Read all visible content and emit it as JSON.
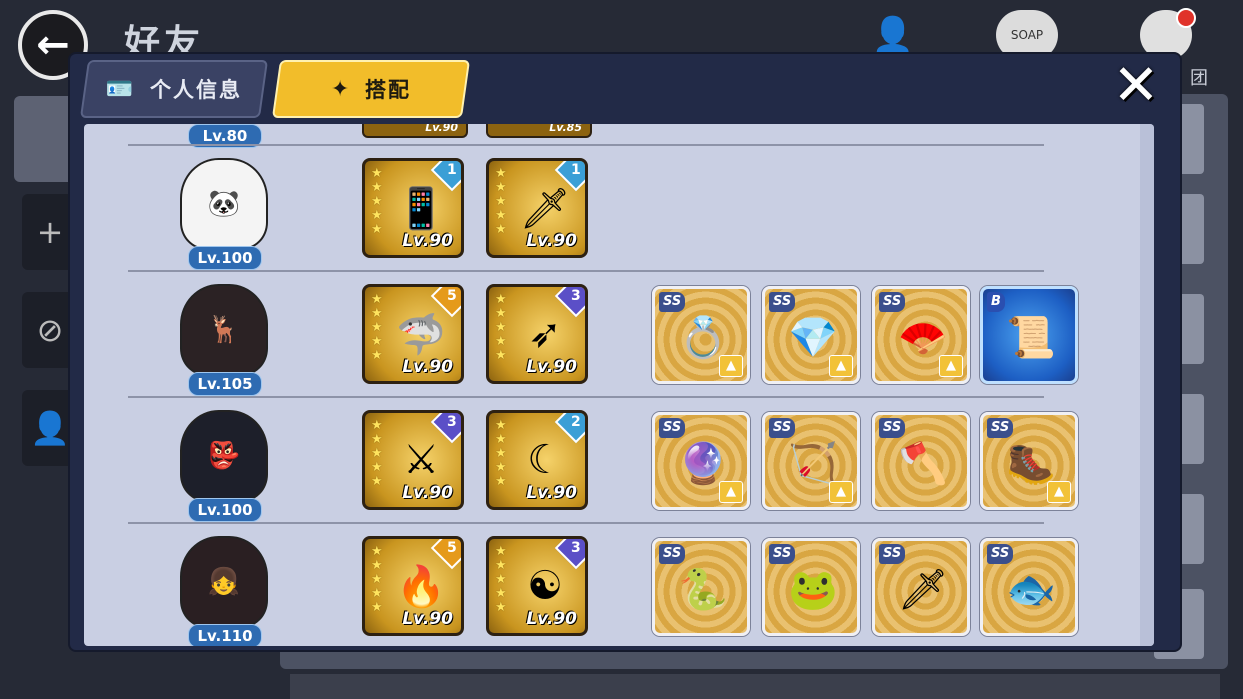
{
  "background": {
    "title": "好友",
    "top_icon_soap": "SOAP",
    "top_icon_label": "团",
    "back_icon": "back-arrow-icon"
  },
  "modal": {
    "tabs": [
      {
        "label": "个人信息",
        "icon": "profile-card-icon",
        "active": false
      },
      {
        "label": "搭配",
        "icon": "shuriken-icon",
        "active": true
      }
    ],
    "close_icon": "close-x-icon"
  },
  "partial_row": {
    "level": "Lv.80",
    "weapon_levels": [
      "Lv.90",
      "Lv.85"
    ]
  },
  "rows": [
    {
      "level": "Lv.100",
      "avatar": "panda-ninja",
      "weapons": [
        {
          "rank": "1",
          "rank_color": "teal",
          "level": "Lv.90",
          "icon": "phone-blade-icon"
        },
        {
          "rank": "1",
          "rank_color": "teal",
          "level": "Lv.90",
          "icon": "fan-blade-icon"
        }
      ],
      "gear": []
    },
    {
      "level": "Lv.105",
      "avatar": "deer-horn-girl",
      "weapons": [
        {
          "rank": "5",
          "rank_color": "orange",
          "level": "Lv.90",
          "icon": "shark-blade-icon"
        },
        {
          "rank": "3",
          "rank_color": "purple",
          "level": "Lv.90",
          "icon": "arrow-spear-icon"
        }
      ],
      "gear": [
        {
          "grade": "SS",
          "icon": "jade-ring-icon"
        },
        {
          "grade": "SS",
          "icon": "crystal-feather-icon"
        },
        {
          "grade": "SS",
          "icon": "red-fan-icon"
        },
        {
          "grade": "B",
          "icon": "scroll-icon",
          "special": true
        }
      ]
    },
    {
      "level": "Lv.100",
      "avatar": "masked-ninja",
      "weapons": [
        {
          "rank": "3",
          "rank_color": "purple",
          "level": "Lv.90",
          "icon": "dark-katana-icon"
        },
        {
          "rank": "2",
          "rank_color": "teal",
          "level": "Lv.90",
          "icon": "scythe-icon"
        }
      ],
      "gear": [
        {
          "grade": "SS",
          "icon": "purple-ring-icon"
        },
        {
          "grade": "SS",
          "icon": "winged-arrow-icon"
        },
        {
          "grade": "SS",
          "icon": "double-axe-icon"
        },
        {
          "grade": "SS",
          "icon": "claw-boots-icon"
        }
      ]
    },
    {
      "level": "Lv.110",
      "avatar": "bun-hair-girl",
      "weapons": [
        {
          "rank": "5",
          "rank_color": "orange",
          "level": "Lv.90",
          "icon": "flame-staff-icon"
        },
        {
          "rank": "3",
          "rank_color": "purple",
          "level": "Lv.90",
          "icon": "tomoe-spear-icon"
        }
      ],
      "gear": [
        {
          "grade": "SS",
          "icon": "snake-ring-icon"
        },
        {
          "grade": "SS",
          "icon": "frog-scroll-icon"
        },
        {
          "grade": "SS",
          "icon": "frog-dagger-icon"
        },
        {
          "grade": "SS",
          "icon": "frog-orb-icon"
        }
      ]
    }
  ]
}
